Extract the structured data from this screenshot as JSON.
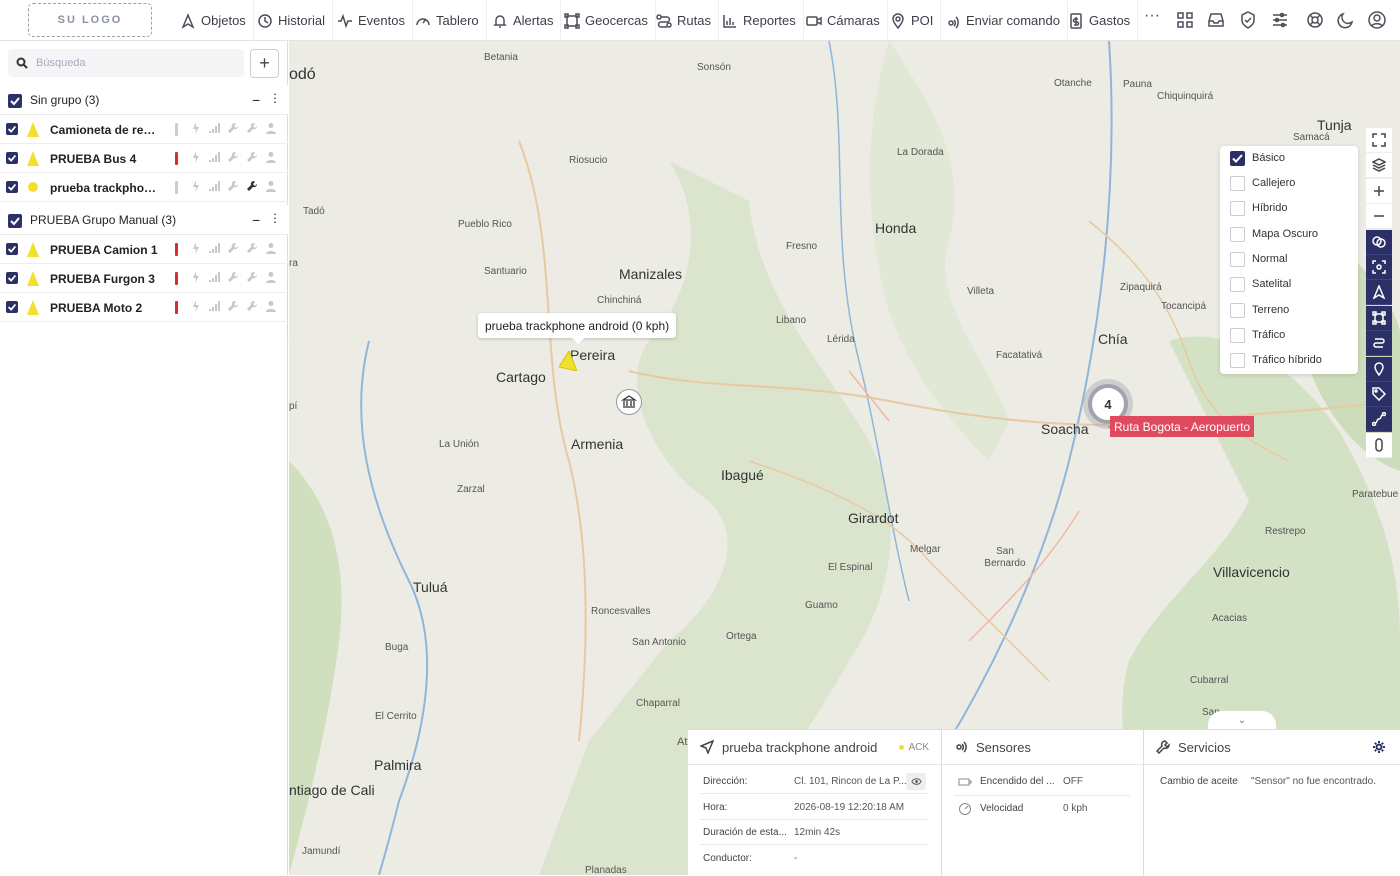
{
  "logo": "SU LOGO",
  "nav": [
    {
      "label": "Objetos",
      "icon": "navigation-icon"
    },
    {
      "label": "Historial",
      "icon": "history-icon"
    },
    {
      "label": "Eventos",
      "icon": "pulse-icon"
    },
    {
      "label": "Tablero",
      "icon": "gauge-icon"
    },
    {
      "label": "Alertas",
      "icon": "bell-icon"
    },
    {
      "label": "Geocercas",
      "icon": "geofence-icon"
    },
    {
      "label": "Rutas",
      "icon": "route-icon"
    },
    {
      "label": "Reportes",
      "icon": "bar-chart-icon"
    },
    {
      "label": "Cámaras",
      "icon": "camera-icon"
    },
    {
      "label": "POI",
      "icon": "pin-icon"
    },
    {
      "label": "Enviar comando",
      "icon": "send-command-icon"
    },
    {
      "label": "Gastos",
      "icon": "expense-icon"
    }
  ],
  "sidebar": {
    "search_placeholder": "Búsqueda",
    "groups": [
      {
        "name": "Sin grupo (3)",
        "objects": [
          {
            "name": "Camioneta de rep...",
            "status": "gray",
            "icon": "arrow"
          },
          {
            "name": "PRUEBA Bus 4",
            "status": "red",
            "icon": "arrow"
          },
          {
            "name": "prueba trackphon...",
            "status": "gray",
            "icon": "dot"
          }
        ]
      },
      {
        "name": "PRUEBA Grupo Manual (3)",
        "objects": [
          {
            "name": "PRUEBA Camion 1",
            "status": "red",
            "icon": "arrow"
          },
          {
            "name": "PRUEBA Furgon 3",
            "status": "red",
            "icon": "arrow"
          },
          {
            "name": "PRUEBA Moto 2",
            "status": "red",
            "icon": "arrow"
          }
        ]
      }
    ]
  },
  "map": {
    "tooltip": "prueba trackphone android (0 kph)",
    "cluster_count": "4",
    "route_label": "Ruta Bogota - Aeropuerto",
    "places": [
      "odó",
      "Betania",
      "Sonsón",
      "Otanche",
      "Pauna",
      "Chiquinquirá",
      "Tunja",
      "Samacá",
      "Riosucio",
      "La Dorada",
      "Tadó",
      "Pueblo Rico",
      "Honda",
      "Fresno",
      "Santuario",
      "Manizales",
      "Chinchiná",
      "Villeta",
      "Zipaquirá",
      "Tocancipá",
      "Libano",
      "Lérida",
      "Pereira",
      "Facatativá",
      "Chía",
      "Cartago",
      "Soacha",
      "La Unión",
      "Armenia",
      "Ibagué",
      "Zarzal",
      "Girardot",
      "Paratebue",
      "Melgar",
      "Restrepo",
      "San Bernardo",
      "El Espinal",
      "Tuluá",
      "Villavicencio",
      "Guamo",
      "Roncesvalles",
      "Acacias",
      "San Antonio",
      "Ortega",
      "Buga",
      "Chaparral",
      "Cubarral",
      "El Cerrito",
      "Palmira",
      "ntiago de Cali",
      "Jamundí",
      "Planadas",
      "San",
      "pí",
      "ra"
    ]
  },
  "layers": [
    "Básico",
    "Callejero",
    "Híbrido",
    "Mapa Oscuro",
    "Normal",
    "Satelital",
    "Terreno",
    "Tráfico",
    "Tráfico híbrido"
  ],
  "layers_selected": "Básico",
  "bottom": {
    "a_label": "At",
    "device": {
      "title": "prueba trackphone android",
      "ack": "ACK",
      "rows": [
        {
          "k": "Dirección:",
          "v": "Cl. 101, Rincon de La P..."
        },
        {
          "k": "Hora:",
          "v": "2026-08-19 12:20:18 AM"
        },
        {
          "k": "Duración de esta...",
          "v": "12min 42s"
        },
        {
          "k": "Conductor:",
          "v": "-"
        }
      ]
    },
    "sensors": {
      "title": "Sensores",
      "rows": [
        {
          "k": "Encendido del ...",
          "v": "OFF"
        },
        {
          "k": "Velocidad",
          "v": "0 kph"
        }
      ]
    },
    "services": {
      "title": "Servicios",
      "rows": [
        {
          "k": "Cambio de aceite",
          "v": "\"Sensor\" no fue encontrado."
        }
      ]
    }
  },
  "colors": {
    "brand": "#2b3167",
    "route": "#e04a5f",
    "status_red": "#d32f2f",
    "marker_yellow": "#f2e030"
  }
}
